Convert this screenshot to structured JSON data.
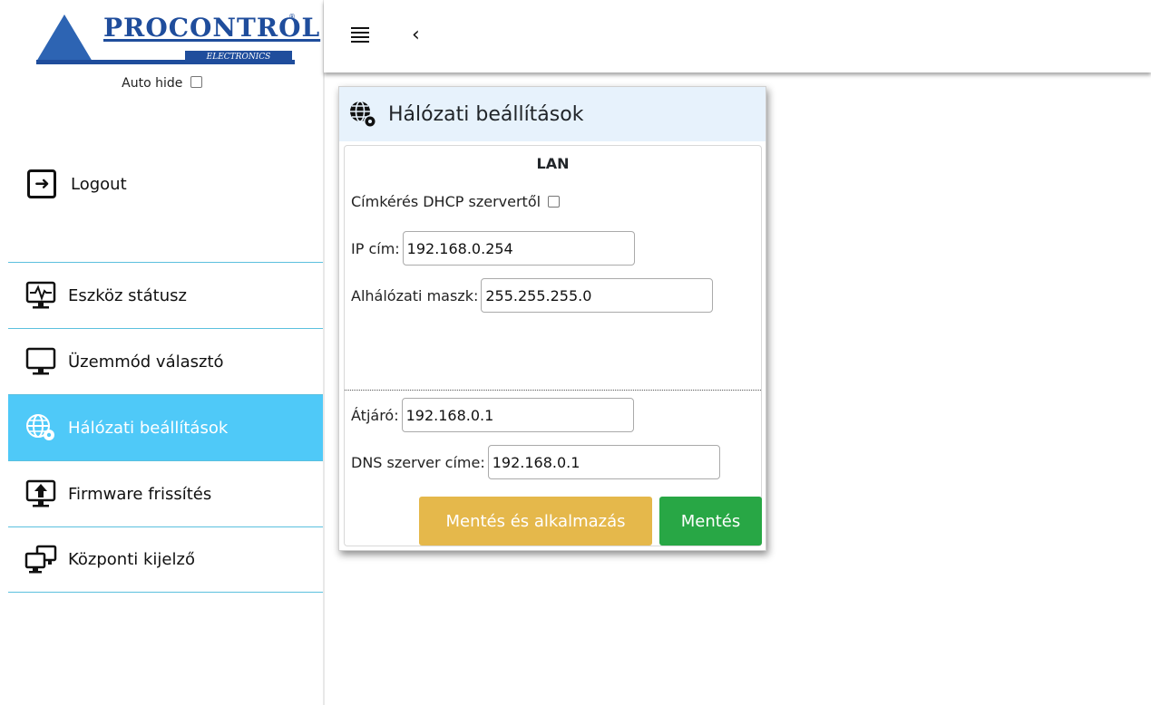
{
  "brand": {
    "name": "PROCONTROL",
    "registered": "®",
    "subtitle": "ELECTRONICS"
  },
  "sidebar": {
    "auto_hide_label": "Auto hide",
    "auto_hide_checked": false,
    "logout_label": "Logout",
    "items": [
      {
        "label": "Eszköz státusz",
        "icon": "monitor-pulse-icon",
        "active": false
      },
      {
        "label": "Üzemmód választó",
        "icon": "monitor-icon",
        "active": false
      },
      {
        "label": "Hálózati beállítások",
        "icon": "globe-gear-icon",
        "active": true
      },
      {
        "label": "Firmware frissítés",
        "icon": "monitor-upload-icon",
        "active": false
      },
      {
        "label": "Központi kijelző",
        "icon": "dual-monitor-icon",
        "active": false
      }
    ]
  },
  "topbar": {
    "menu_icon": "hamburger-icon",
    "back_glyph": "‹"
  },
  "panel": {
    "title": "Hálózati beállítások",
    "section": "LAN",
    "dhcp_label": "Címkérés DHCP szervertől",
    "dhcp_checked": false,
    "ip_label": "IP cím:",
    "ip_value": "192.168.0.254",
    "mask_label": "Alhálózati maszk:",
    "mask_value": "255.255.255.0",
    "gateway_label": "Átjáró:",
    "gateway_value": "192.168.0.1",
    "dns_label": "DNS szerver címe:",
    "dns_value": "192.168.0.1",
    "save_apply_label": "Mentés és alkalmazás",
    "save_label": "Mentés"
  },
  "colors": {
    "active_nav": "#4fc9f8",
    "nav_divider": "#5bc0de",
    "save_apply": "#e5b84b",
    "save": "#28a745",
    "brand_blue": "#1f4d9c"
  }
}
